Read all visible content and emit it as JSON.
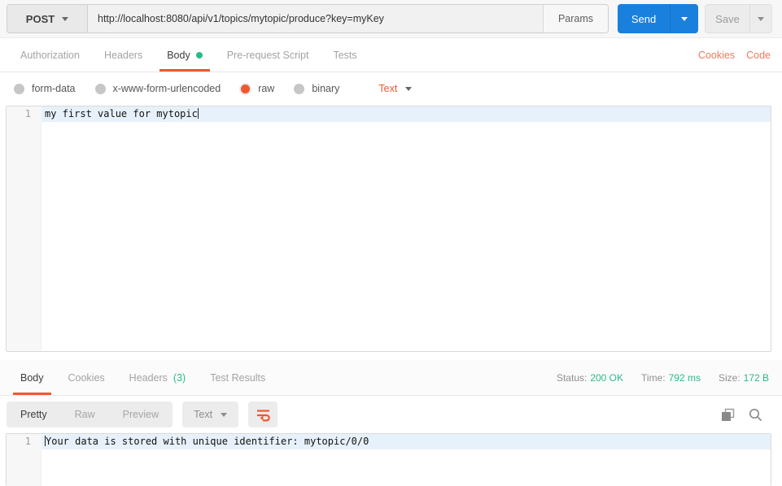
{
  "request_bar": {
    "method": "POST",
    "url": "http://localhost:8080/api/v1/topics/mytopic/produce?key=myKey",
    "params_label": "Params",
    "send_label": "Send",
    "save_label": "Save"
  },
  "request_tabs": {
    "items": [
      {
        "label": "Authorization"
      },
      {
        "label": "Headers"
      },
      {
        "label": "Body"
      },
      {
        "label": "Pre-request Script"
      },
      {
        "label": "Tests"
      }
    ],
    "cookies_link": "Cookies",
    "code_link": "Code"
  },
  "body_options": {
    "modes": [
      {
        "label": "form-data",
        "selected": false
      },
      {
        "label": "x-www-form-urlencoded",
        "selected": false
      },
      {
        "label": "raw",
        "selected": true
      },
      {
        "label": "binary",
        "selected": false
      }
    ],
    "format_label": "Text"
  },
  "request_editor": {
    "line_number": "1",
    "content": "my first value for mytopic"
  },
  "response": {
    "tabs": [
      {
        "label": "Body"
      },
      {
        "label": "Cookies"
      },
      {
        "label": "Headers",
        "count": "(3)"
      },
      {
        "label": "Test Results"
      }
    ],
    "meta": {
      "status_label": "Status:",
      "status_value": "200 OK",
      "time_label": "Time:",
      "time_value": "792 ms",
      "size_label": "Size:",
      "size_value": "172 B"
    },
    "view_tabs": [
      {
        "label": "Pretty"
      },
      {
        "label": "Raw"
      },
      {
        "label": "Preview"
      }
    ],
    "format_label": "Text",
    "icons": [
      "wrap-text-icon",
      "copy-icon",
      "search-icon"
    ],
    "editor": {
      "line_number": "1",
      "content": "Your data is stored with unique identifier: mytopic/0/0"
    }
  },
  "colors": {
    "accent_orange": "#f0582f",
    "link_orange": "#ee7a5e",
    "status_green": "#29bb87",
    "send_blue": "#1a80dd",
    "line_highlight": "#e7f1fb"
  }
}
